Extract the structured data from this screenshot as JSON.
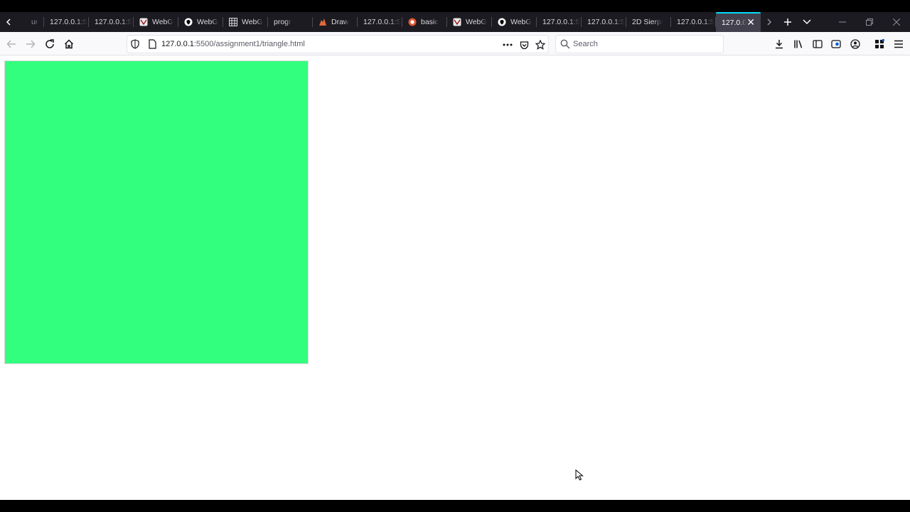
{
  "window": {
    "tabs": [
      {
        "label": "ur",
        "icon": "none"
      },
      {
        "label": "127.0.0.1:5",
        "icon": "none"
      },
      {
        "label": "127.0.0.1:5",
        "icon": "none"
      },
      {
        "label": "WebG",
        "icon": "webgl-icon"
      },
      {
        "label": "WebG",
        "icon": "github-icon"
      },
      {
        "label": "WebG",
        "icon": "grid-icon"
      },
      {
        "label": "progr",
        "icon": "none"
      },
      {
        "label": "Draw",
        "icon": "draw-icon"
      },
      {
        "label": "127.0.0.1:5",
        "icon": "none"
      },
      {
        "label": "basic",
        "icon": "duckduckgo-icon"
      },
      {
        "label": "WebG",
        "icon": "webgl-icon"
      },
      {
        "label": "WebG",
        "icon": "github-icon"
      },
      {
        "label": "127.0.0.1:5",
        "icon": "none"
      },
      {
        "label": "127.0.0.1:5",
        "icon": "none"
      },
      {
        "label": "2D Sierpi",
        "icon": "none"
      },
      {
        "label": "127.0.0.1:5",
        "icon": "none"
      }
    ],
    "active_tab": {
      "label": "127.0.0",
      "close": "✕"
    },
    "accent_color": "#00ddff"
  },
  "navbar": {
    "url_host": "127.0.0.1",
    "url_rest": ":5500/assignment1/triangle.html",
    "search_placeholder": "Search"
  },
  "content": {
    "canvas_color": "#33ff7f"
  }
}
